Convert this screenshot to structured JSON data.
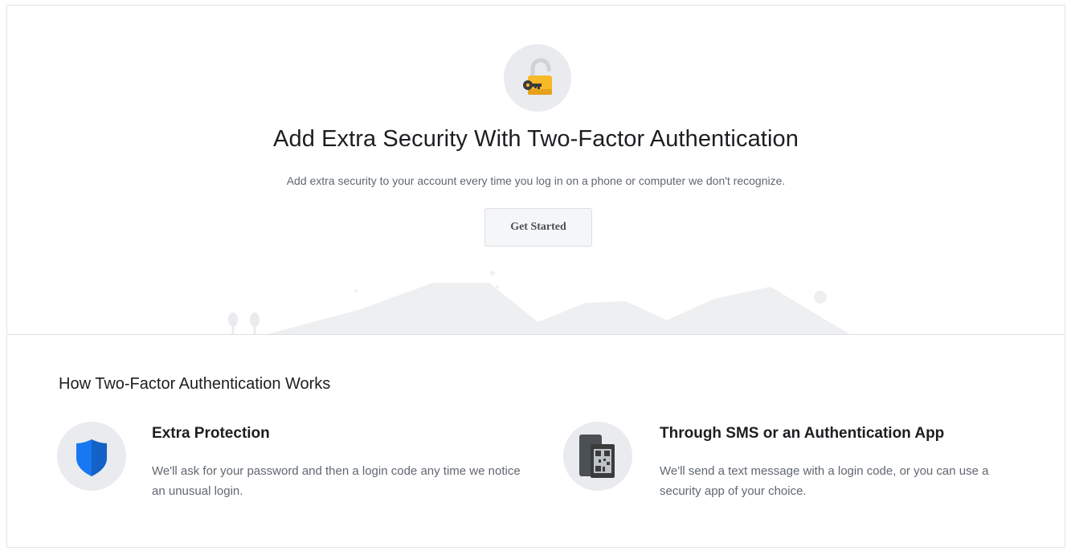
{
  "hero": {
    "icon": "lock-key-icon",
    "title": "Add Extra Security With Two-Factor Authentication",
    "subtitle": "Add extra security to your account every time you log in on a phone or computer we don't recognize.",
    "button_label": "Get Started"
  },
  "how": {
    "title": "How Two-Factor Authentication Works",
    "features": [
      {
        "icon": "shield-icon",
        "title": "Extra Protection",
        "description": "We'll ask for your password and then a login code any time we notice an unusual login."
      },
      {
        "icon": "phone-qr-icon",
        "title": "Through SMS or an Authentication App",
        "description": "We'll send a text message with a login code, or you can use a security app of your choice."
      }
    ]
  },
  "colors": {
    "title_text": "#1c1e21",
    "secondary_text": "#606770",
    "lock_yellow": "#f7b928",
    "shield_blue": "#1877f2",
    "icon_background": "#e9ebee"
  }
}
